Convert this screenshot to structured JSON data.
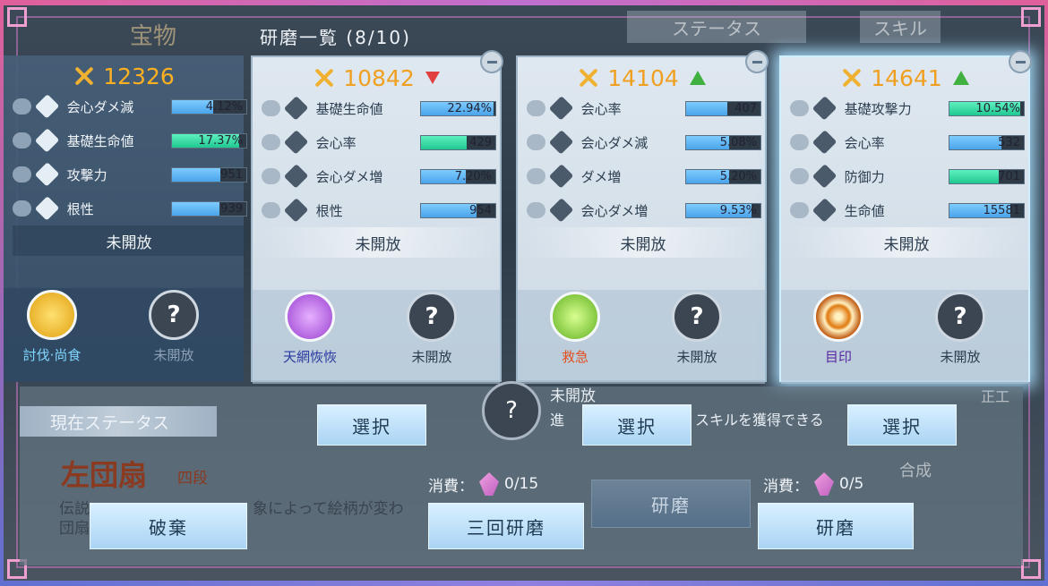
{
  "header": {
    "title": "研磨一覧 (8/10)",
    "bg_treasure": "宝物",
    "tab_status": "ステータス",
    "tab_skill": "スキル"
  },
  "cards": [
    {
      "power": "12326",
      "trend": "none",
      "stats": [
        {
          "name": "会心ダメ減",
          "value": "4.12%",
          "fill": 0.55,
          "color": "blue"
        },
        {
          "name": "基礎生命値",
          "value": "17.37%",
          "fill": 0.9,
          "color": "green"
        },
        {
          "name": "攻撃力",
          "value": "951",
          "fill": 0.65,
          "color": "blue"
        },
        {
          "name": "根性",
          "value": "939",
          "fill": 0.64,
          "color": "blue"
        }
      ],
      "locked": "未開放",
      "skills": [
        {
          "label": "討伐·尚食",
          "icon": "crab-skill-icon",
          "color": "#f0c020",
          "label_color": "#7fd6ff"
        },
        {
          "label": "未開放",
          "icon": "question-icon",
          "color": "#3b4652",
          "label_color": "#8aa0b4"
        }
      ]
    },
    {
      "power": "10842",
      "trend": "down",
      "stats": [
        {
          "name": "基礎生命値",
          "value": "22.94%",
          "fill": 0.98,
          "color": "blue"
        },
        {
          "name": "会心率",
          "value": "429",
          "fill": 0.62,
          "color": "green"
        },
        {
          "name": "会心ダメ増",
          "value": "7.20%",
          "fill": 0.6,
          "color": "blue"
        },
        {
          "name": "根性",
          "value": "954",
          "fill": 0.75,
          "color": "blue"
        }
      ],
      "locked": "未開放",
      "skills": [
        {
          "label": "天網恢恢",
          "icon": "purple-orb-icon",
          "color": "#b060e0",
          "label_color": "#2a3aa0"
        },
        {
          "label": "未開放",
          "icon": "question-icon",
          "color": "#3b4652",
          "label_color": "#2c3e50"
        }
      ]
    },
    {
      "power": "14104",
      "trend": "up",
      "stats": [
        {
          "name": "会心率",
          "value": "407",
          "fill": 0.55,
          "color": "blue"
        },
        {
          "name": "会心ダメ減",
          "value": "5.08%",
          "fill": 0.58,
          "color": "blue"
        },
        {
          "name": "ダメ増",
          "value": "5.20%",
          "fill": 0.58,
          "color": "blue"
        },
        {
          "name": "会心ダメ増",
          "value": "9.53%",
          "fill": 0.88,
          "color": "blue"
        }
      ],
      "locked": "未開放",
      "skills": [
        {
          "label": "救急",
          "icon": "green-heal-icon",
          "color": "#70d040",
          "label_color": "#e05020"
        },
        {
          "label": "未開放",
          "icon": "question-icon",
          "color": "#3b4652",
          "label_color": "#2c3e50"
        }
      ]
    },
    {
      "power": "14641",
      "trend": "up",
      "stats": [
        {
          "name": "基礎攻撃力",
          "value": "10.54%",
          "fill": 0.95,
          "color": "green"
        },
        {
          "name": "会心率",
          "value": "532",
          "fill": 0.7,
          "color": "blue"
        },
        {
          "name": "防御力",
          "value": "701",
          "fill": 0.66,
          "color": "green"
        },
        {
          "name": "生命値",
          "value": "15581",
          "fill": 0.82,
          "color": "blue"
        }
      ],
      "locked": "未開放",
      "skills": [
        {
          "label": "目印",
          "icon": "target-icon",
          "color": "#e08020",
          "label_color": "#5a2aa0"
        },
        {
          "label": "未開放",
          "icon": "question-icon",
          "color": "#3b4652",
          "label_color": "#2c3e50"
        }
      ]
    }
  ],
  "buttons": {
    "select": "選択",
    "discard": "破棄",
    "triple_polish": "三回研磨",
    "polish": "研磨"
  },
  "lower": {
    "status_tab": "現在ステータス",
    "item_name": "左団扇",
    "item_rank": "四段",
    "desc_line1": "伝説",
    "desc_line1b": "象によって絵柄が変わ",
    "desc_line2": "団扇",
    "cost_label": "消費：",
    "cost_triple": "0/15",
    "cost_single": "0/5",
    "bg_unlock_title": "未開放",
    "bg_unlock_desc": "進",
    "bg_unlock_desc2": "スキルを獲得できる",
    "bg_right1": "正工",
    "bg_right2": "合成"
  }
}
